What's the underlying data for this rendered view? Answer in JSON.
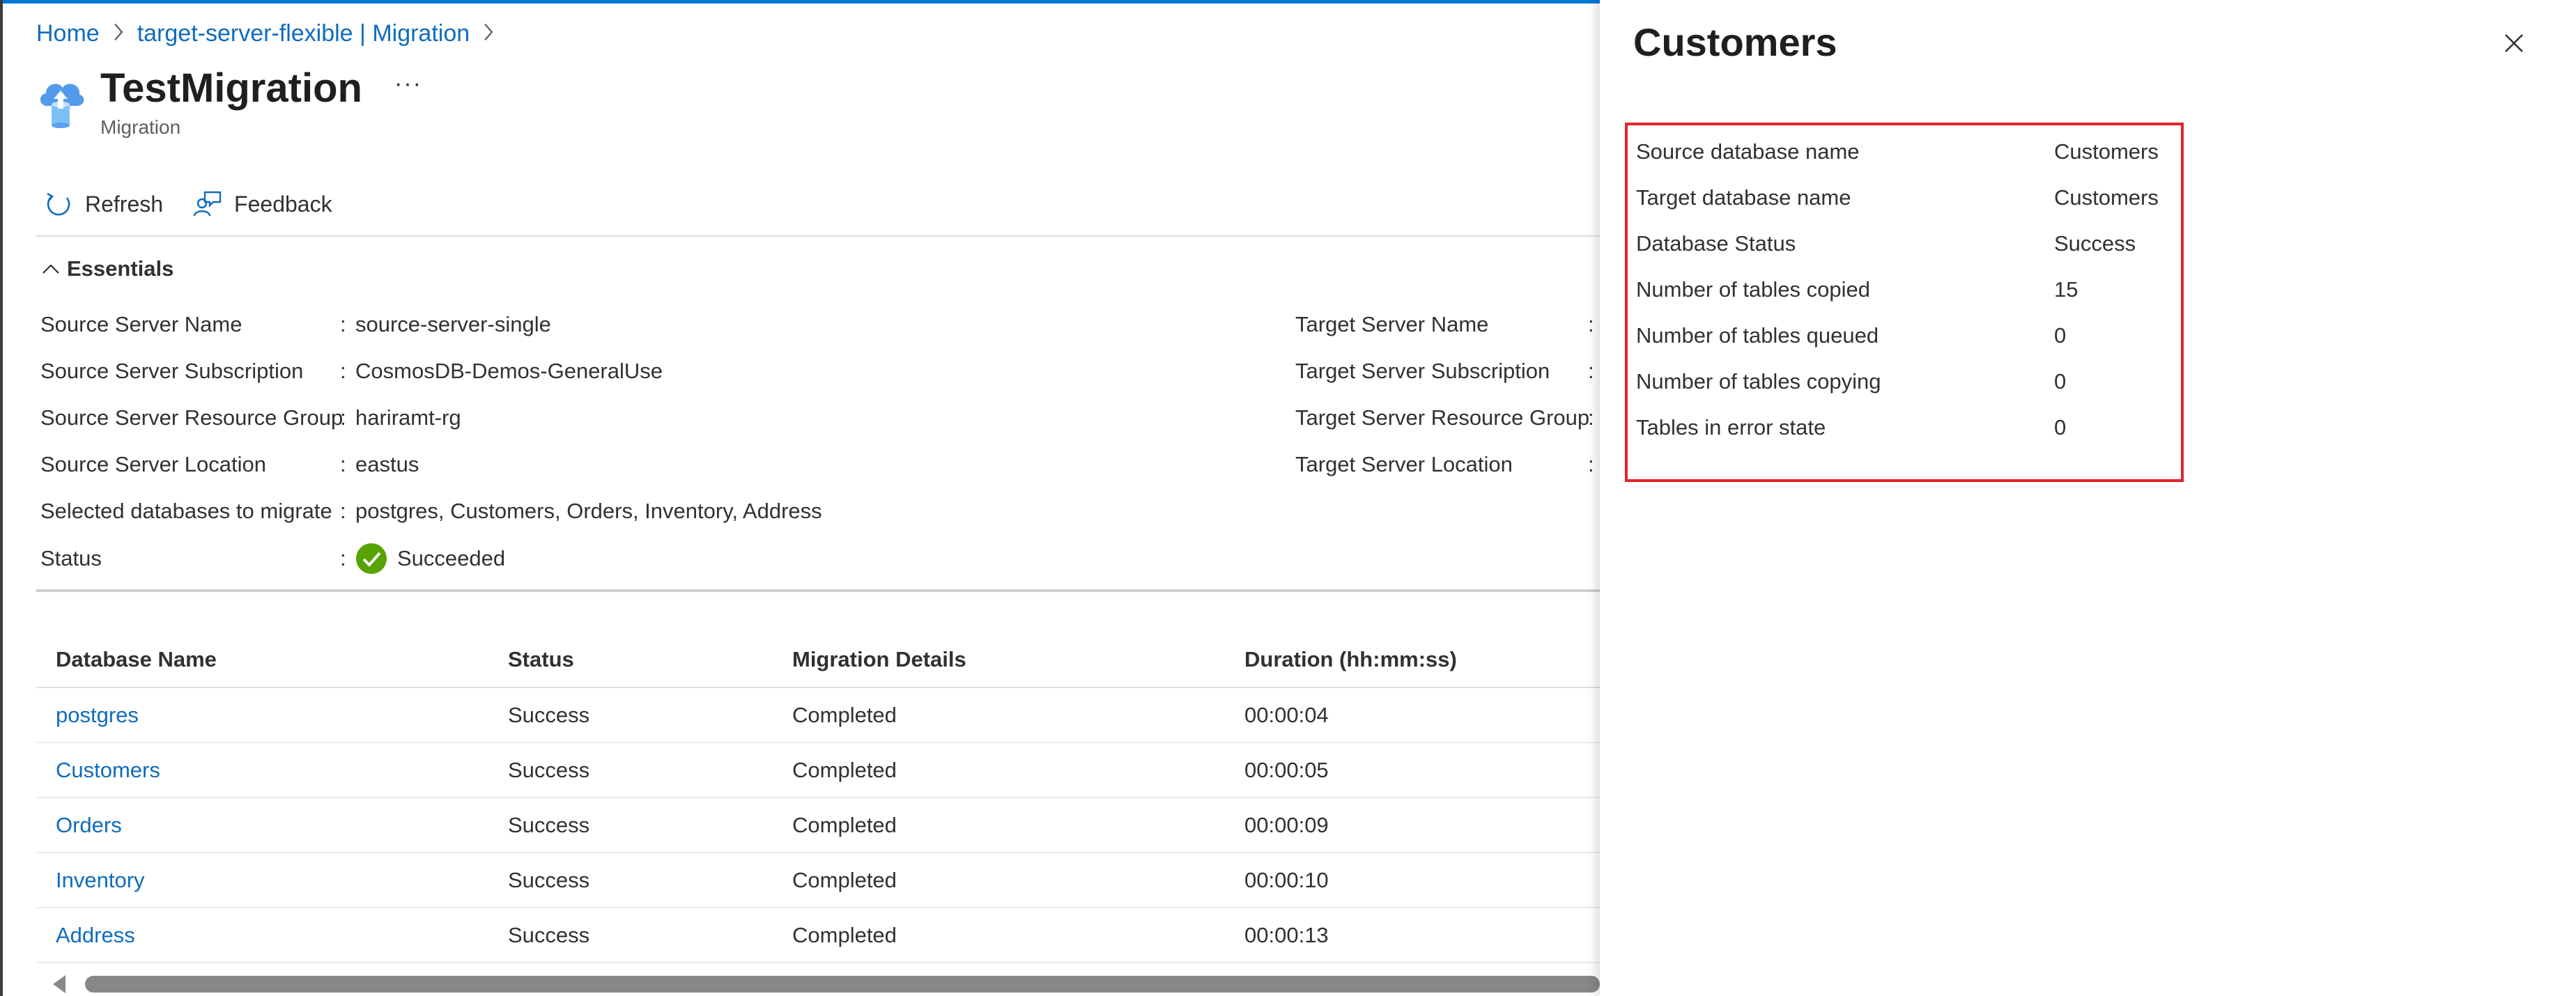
{
  "breadcrumb": {
    "items": [
      "Home",
      "target-server-flexible | Migration"
    ]
  },
  "header": {
    "title": "TestMigration",
    "subtitle": "Migration",
    "more": "···"
  },
  "toolbar": {
    "refresh_label": "Refresh",
    "feedback_label": "Feedback"
  },
  "essentials": {
    "header": "Essentials",
    "colon": ":",
    "left": [
      {
        "label": "Source Server Name",
        "value": "source-server-single"
      },
      {
        "label": "Source Server Subscription",
        "value": "CosmosDB-Demos-GeneralUse"
      },
      {
        "label": "Source Server Resource Group",
        "value": "hariramt-rg"
      },
      {
        "label": "Source Server Location",
        "value": "eastus"
      },
      {
        "label": "Selected databases to migrate",
        "value": "postgres, Customers, Orders, Inventory, Address"
      },
      {
        "label": "Status",
        "value": "Succeeded"
      }
    ],
    "right": [
      {
        "label": "Target Server Name"
      },
      {
        "label": "Target Server Subscription"
      },
      {
        "label": "Target Server Resource Group"
      },
      {
        "label": "Target Server Location"
      }
    ]
  },
  "table": {
    "columns": [
      "Database Name",
      "Status",
      "Migration Details",
      "Duration (hh:mm:ss)"
    ],
    "rows": [
      {
        "name": "postgres",
        "status": "Success",
        "details": "Completed",
        "duration": "00:00:04"
      },
      {
        "name": "Customers",
        "status": "Success",
        "details": "Completed",
        "duration": "00:00:05"
      },
      {
        "name": "Orders",
        "status": "Success",
        "details": "Completed",
        "duration": "00:00:09"
      },
      {
        "name": "Inventory",
        "status": "Success",
        "details": "Completed",
        "duration": "00:00:10"
      },
      {
        "name": "Address",
        "status": "Success",
        "details": "Completed",
        "duration": "00:00:13"
      }
    ]
  },
  "panel": {
    "title": "Customers",
    "details": [
      {
        "label": "Source database name",
        "value": "Customers"
      },
      {
        "label": "Target database name",
        "value": "Customers"
      },
      {
        "label": "Database Status",
        "value": "Success"
      },
      {
        "label": "Number of tables copied",
        "value": "15"
      },
      {
        "label": "Number of tables queued",
        "value": "0"
      },
      {
        "label": "Number of tables copying",
        "value": "0"
      },
      {
        "label": "Tables in error state",
        "value": "0"
      }
    ]
  },
  "icons": {
    "header": "cloud-upload-database-icon",
    "refresh": "refresh-icon",
    "feedback": "feedback-icon",
    "essentials_toggle": "chevron-up-icon",
    "status": "success-check-icon",
    "close": "close-icon"
  },
  "colors": {
    "link": "#0f6cbd",
    "success": "#57a300",
    "highlight_box": "#e3242b"
  }
}
